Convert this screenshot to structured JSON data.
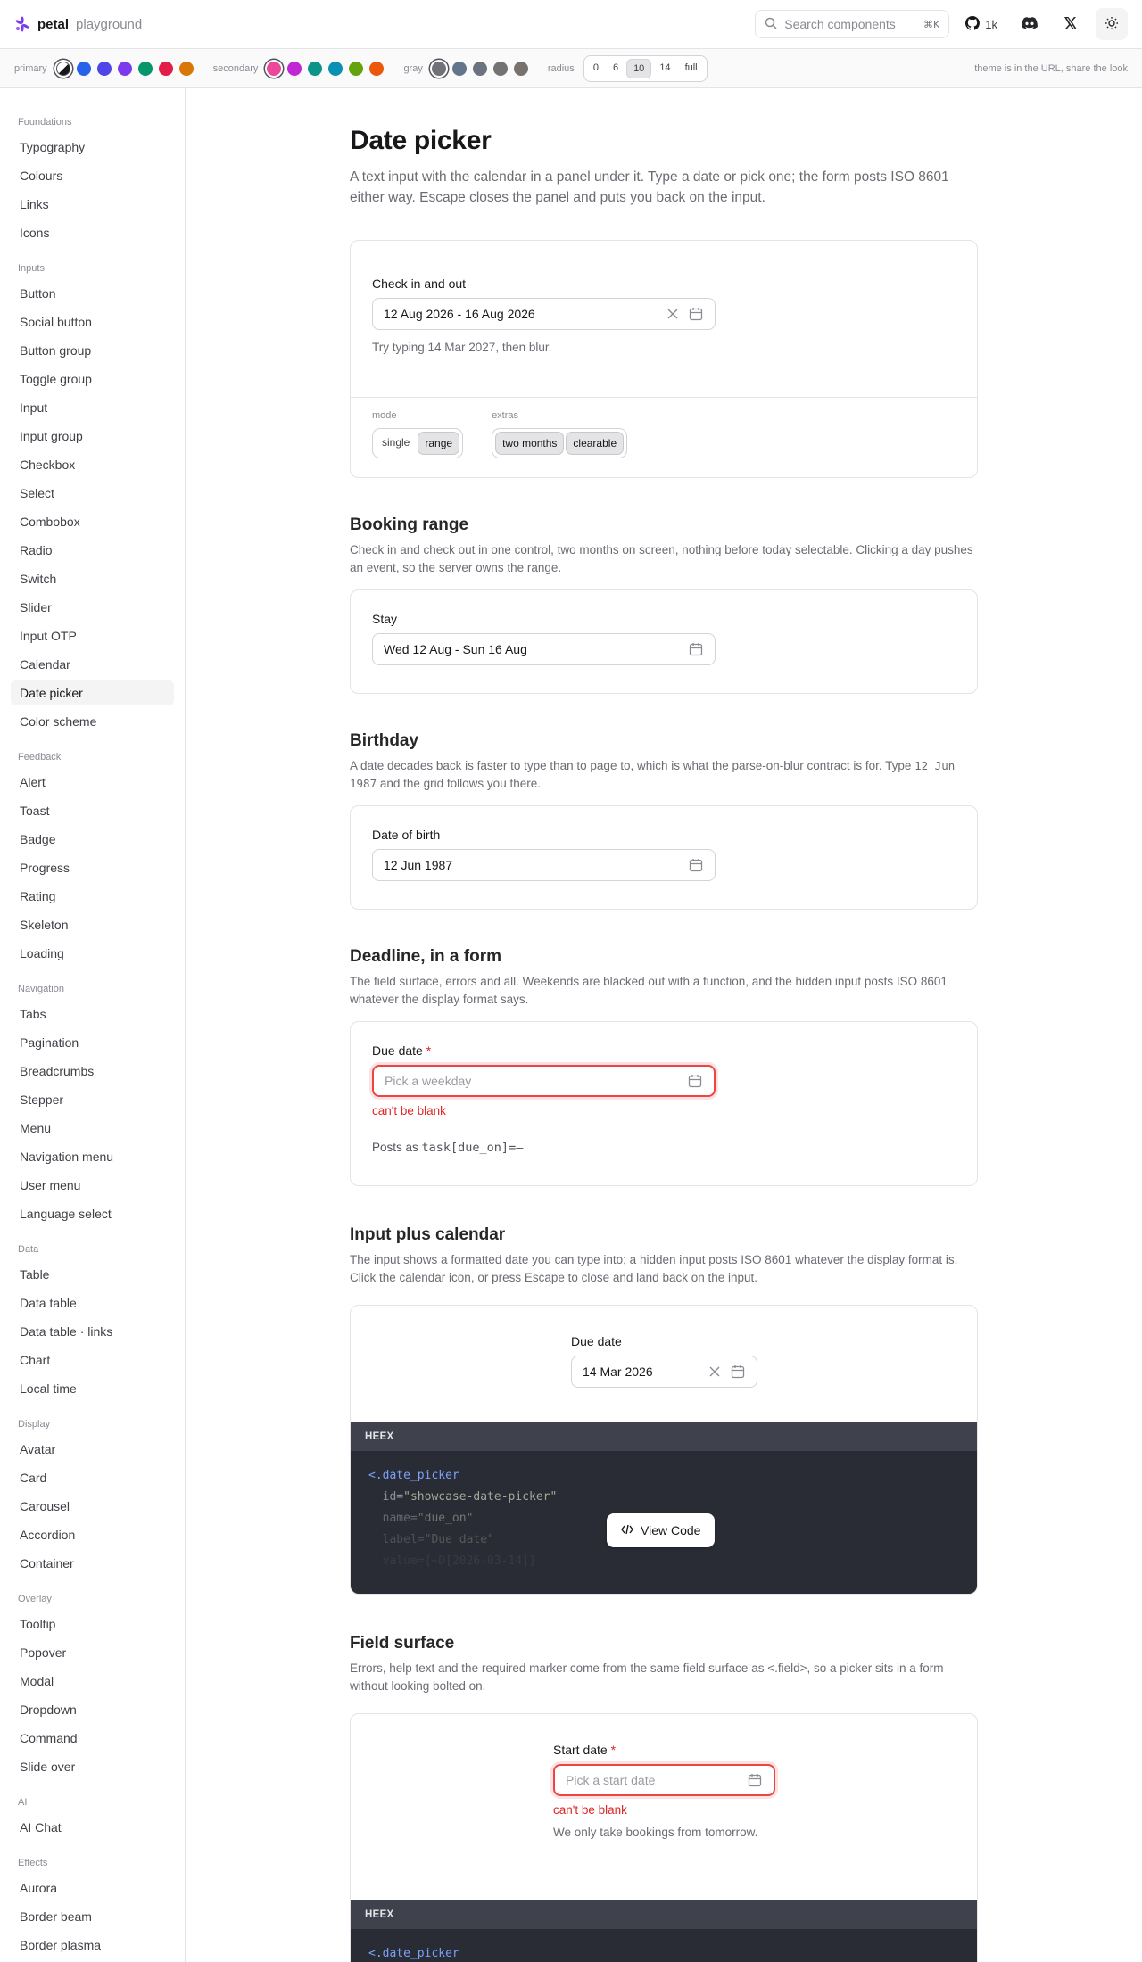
{
  "header": {
    "brand": "petal",
    "brand_sub": "playground",
    "search_placeholder": "Search components",
    "search_shortcut": "⌘K",
    "github_count": "1k"
  },
  "themebar": {
    "primary_label": "primary",
    "primary_colors": [
      "#2563eb",
      "#4f46e5",
      "#7c3aed",
      "#059669",
      "#e11d48",
      "#d97706"
    ],
    "secondary_label": "secondary",
    "secondary_colors": [
      "#ec4899",
      "#c026d3",
      "#0d9488",
      "#0891b2",
      "#65a30d",
      "#ea580c"
    ],
    "gray_label": "gray",
    "gray_colors": [
      "#71717a",
      "#64748b",
      "#6b7280",
      "#737373",
      "#78716c"
    ],
    "radius_label": "radius",
    "radius_options": [
      "0",
      "6",
      "10",
      "14",
      "full"
    ],
    "radius_selected": "10",
    "share_note": "theme is in the URL, share the look"
  },
  "sidebar": {
    "sections": [
      {
        "title": "Foundations",
        "items": [
          "Typography",
          "Colours",
          "Links",
          "Icons"
        ]
      },
      {
        "title": "Inputs",
        "items": [
          "Button",
          "Social button",
          "Button group",
          "Toggle group",
          "Input",
          "Input group",
          "Checkbox",
          "Select",
          "Combobox",
          "Radio",
          "Switch",
          "Slider",
          "Input OTP",
          "Calendar",
          "Date picker",
          "Color scheme"
        ]
      },
      {
        "title": "Feedback",
        "items": [
          "Alert",
          "Toast",
          "Badge",
          "Progress",
          "Rating",
          "Skeleton",
          "Loading"
        ]
      },
      {
        "title": "Navigation",
        "items": [
          "Tabs",
          "Pagination",
          "Breadcrumbs",
          "Stepper",
          "Menu",
          "Navigation menu",
          "User menu",
          "Language select"
        ]
      },
      {
        "title": "Data",
        "items": [
          "Table",
          "Data table",
          "Data table · links",
          "Chart",
          "Local time"
        ]
      },
      {
        "title": "Display",
        "items": [
          "Avatar",
          "Card",
          "Carousel",
          "Accordion",
          "Container"
        ]
      },
      {
        "title": "Overlay",
        "items": [
          "Tooltip",
          "Popover",
          "Modal",
          "Dropdown",
          "Command",
          "Slide over"
        ]
      },
      {
        "title": "AI",
        "items": [
          "AI Chat"
        ]
      },
      {
        "title": "Effects",
        "items": [
          "Aurora",
          "Border beam",
          "Border plasma"
        ]
      }
    ],
    "active": "Date picker"
  },
  "page": {
    "title": "Date picker",
    "description": "A text input with the calendar in a panel under it. Type a date or pick one; the form posts ISO 8601 either way. Escape closes the panel and puts you back on the input."
  },
  "demo": {
    "label": "Check in and out",
    "value": "12 Aug 2026 - 16 Aug 2026",
    "hint": "Try typing 14 Mar 2027, then blur.",
    "mode_label": "mode",
    "mode_options": [
      "single",
      "range"
    ],
    "mode_selected": "range",
    "extras_label": "extras",
    "extras_options": [
      "two months",
      "clearable"
    ]
  },
  "booking": {
    "title": "Booking range",
    "description": "Check in and check out in one control, two months on screen, nothing before today selectable. Clicking a day pushes an event, so the server owns the range.",
    "label": "Stay",
    "value": "Wed 12 Aug - Sun 16 Aug"
  },
  "birthday": {
    "title": "Birthday",
    "desc_before": "A date decades back is faster to type than to page to, which is what the parse-on-blur contract is for. Type ",
    "desc_code": "12 Jun 1987",
    "desc_after": " and the grid follows you there.",
    "label": "Date of birth",
    "value": "12 Jun 1987"
  },
  "deadline": {
    "title": "Deadline, in a form",
    "description": "The field surface, errors and all. Weekends are blacked out with a function, and the hidden input posts ISO 8601 whatever the display format says.",
    "label": "Due date",
    "required_mark": "*",
    "placeholder": "Pick a weekday",
    "error": "can't be blank",
    "posts_prefix": "Posts as ",
    "posts_code": "task[due_on]=–"
  },
  "input_calendar": {
    "title": "Input plus calendar",
    "description": "The input shows a formatted date you can type into; a hidden input posts ISO 8601 whatever the display format is. Click the calendar icon, or press Escape to close and land back on the input.",
    "label": "Due date",
    "value": "14 Mar 2026",
    "code_header": "HEEX",
    "code_lines": [
      {
        "tag": "<.date_picker",
        "attr": "",
        "str": ""
      },
      {
        "tag": "",
        "attr": "  id=",
        "str": "\"showcase-date-picker\""
      },
      {
        "tag": "",
        "attr": "  name=",
        "str": "\"due_on\""
      },
      {
        "tag": "",
        "attr": "  label=",
        "str": "\"Due date\""
      },
      {
        "tag": "",
        "attr": "  value={~D[2026-03-14]}",
        "str": ""
      }
    ],
    "view_code": "View Code"
  },
  "field_surface": {
    "title": "Field surface",
    "description": "Errors, help text and the required marker come from the same field surface as <.field>, so a picker sits in a form without looking bolted on.",
    "label": "Start date",
    "required_mark": "*",
    "placeholder": "Pick a start date",
    "error": "can't be blank",
    "help": "We only take bookings from tomorrow.",
    "code_header": "HEEX",
    "code_first": "<.date_picker"
  }
}
